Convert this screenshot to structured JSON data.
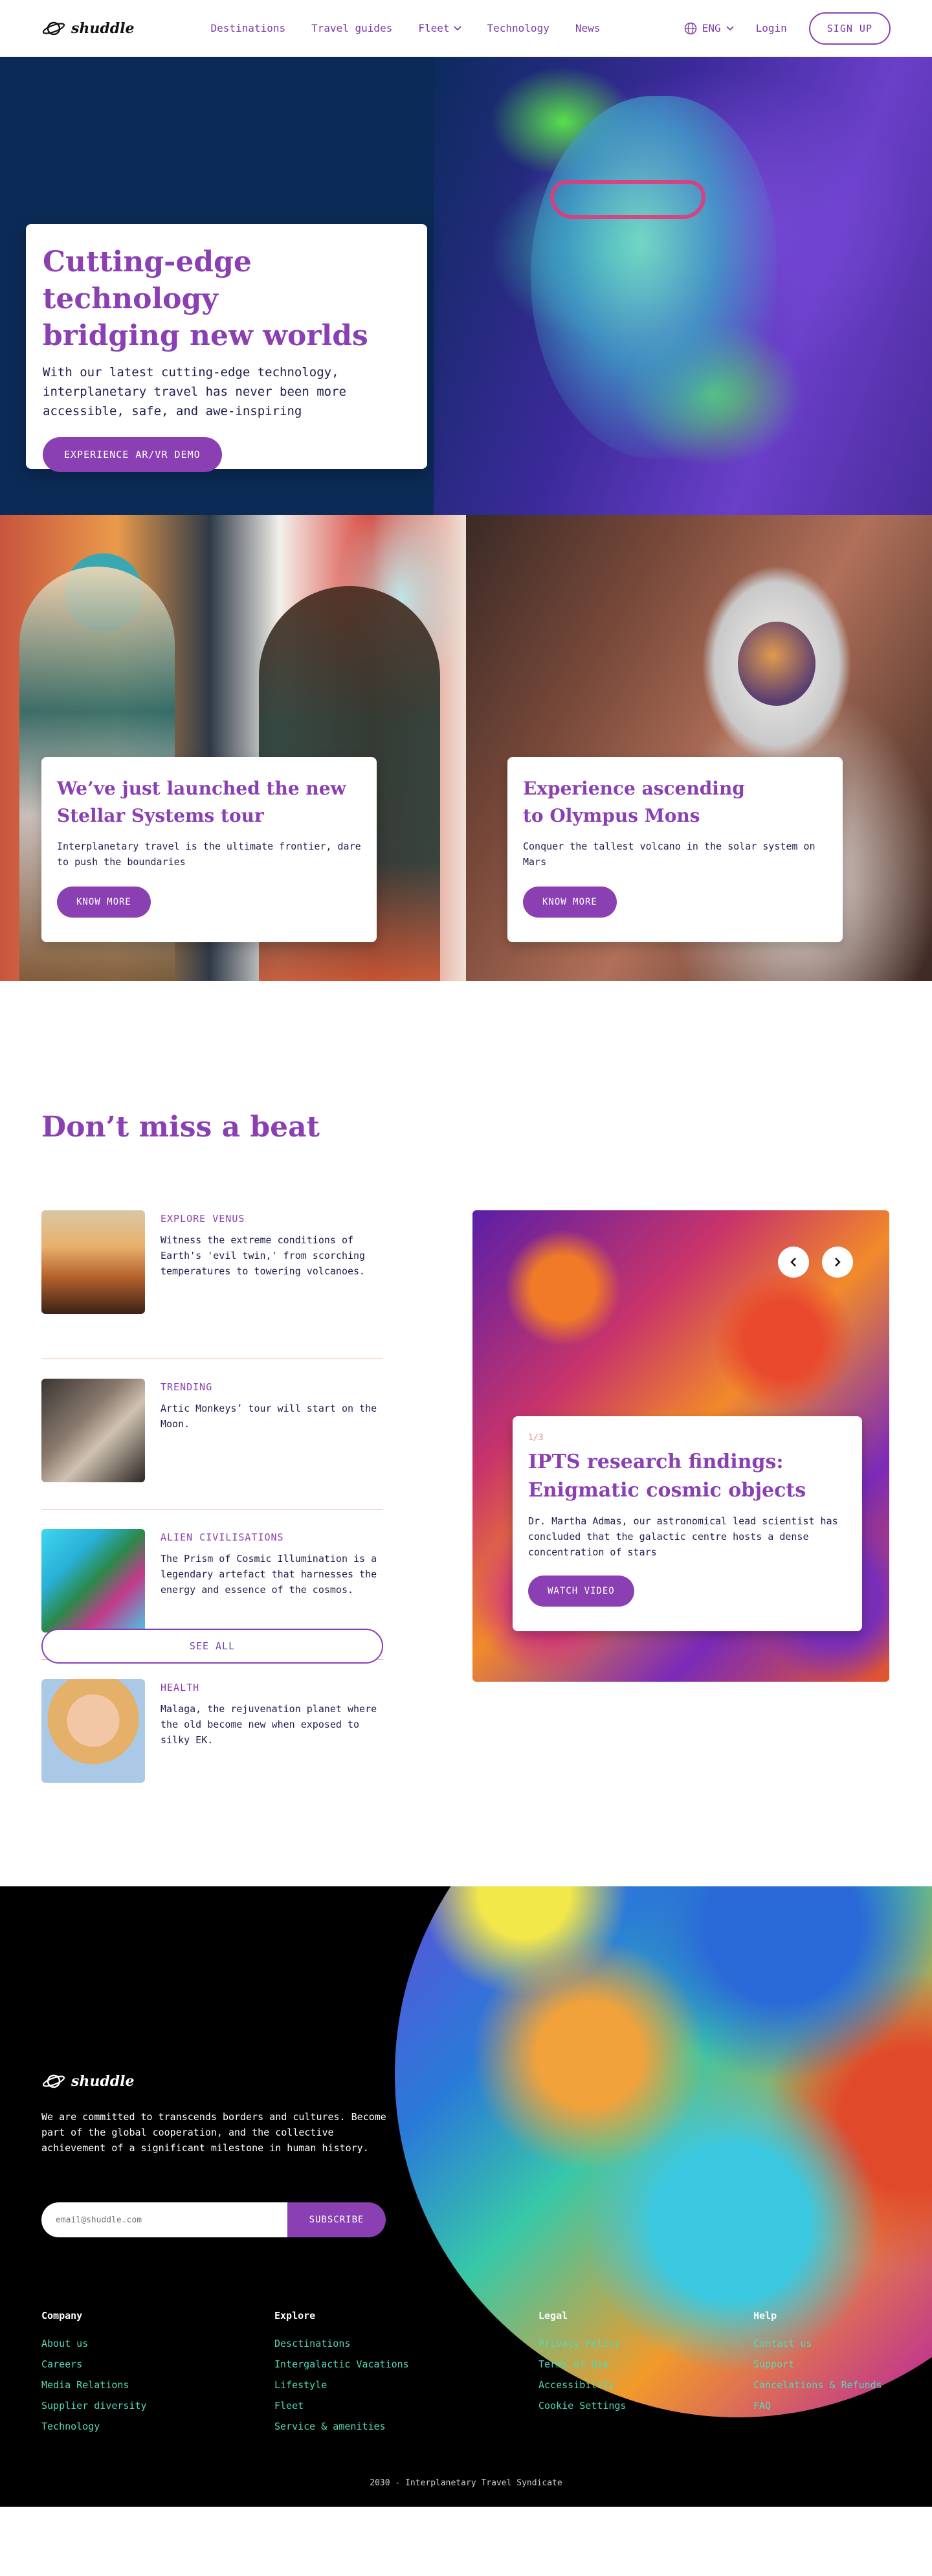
{
  "brand": {
    "name": "shuddle"
  },
  "nav": {
    "links": [
      "Destinations",
      "Travel guides",
      "Fleet",
      "Technology",
      "News"
    ],
    "language": "ENG",
    "login": "Login",
    "signup": "SIGN UP"
  },
  "hero": {
    "title_line1": "Cutting-edge technology",
    "title_line2": "bridging new worlds",
    "body": "With our latest cutting-edge technology, interplanetary travel has never been more accessible, safe, and awe-inspiring",
    "cta": "EXPERIENCE AR/VR DEMO"
  },
  "promos": [
    {
      "title_line1": "We’ve just launched the new",
      "title_line2": "Stellar Systems tour",
      "body": "Interplanetary travel is the ultimate frontier, dare to push the boundaries",
      "cta": "KNOW MORE"
    },
    {
      "title_line1": "Experience ascending",
      "title_line2": "to Olympus Mons",
      "body": "Conquer the tallest volcano in the solar system on Mars",
      "cta": "KNOW MORE"
    }
  ],
  "news": {
    "heading": "Don’t miss a beat",
    "items": [
      {
        "category": "EXPLORE VENUS",
        "text": "Witness the extreme conditions of Earth's 'evil twin,' from scorching temperatures to towering volcanoes."
      },
      {
        "category": "TRENDING",
        "text": "Artic Monkeys’ tour will start on the Moon."
      },
      {
        "category": "ALIEN CIVILISATIONS",
        "text": "The Prism of Cosmic Illumination is a legendary artefact that harnesses the energy and essence of the cosmos."
      },
      {
        "category": "HEALTH",
        "text": "Malaga, the rejuvenation planet where the old become new when exposed to silky EK."
      }
    ],
    "see_all": "SEE ALL",
    "feature": {
      "counter": "1/3",
      "title_line1": "IPTS research findings:",
      "title_line2": "Enigmatic cosmic objects",
      "body": "Dr. Martha Admas, our astronomical lead scientist has concluded that the galactic centre hosts a dense concentration of stars",
      "cta": "WATCH VIDEO"
    }
  },
  "footer": {
    "about": "We are committed to transcends borders and cultures. Become part of the global cooperation, and the collective achievement of a significant milestone in human history.",
    "email_placeholder": "email@shuddle.com",
    "subscribe": "SUBSCRIBE",
    "columns": [
      {
        "title": "Company",
        "links": [
          "About us",
          "Careers",
          "Media Relations",
          "Supplier diversity",
          "Technology"
        ]
      },
      {
        "title": "Explore",
        "links": [
          "Desctinations",
          "Intergalactic Vacations",
          "Lifestyle",
          "Fleet",
          "Service & amenities"
        ]
      },
      {
        "title": "Legal",
        "links": [
          "Privacy Policy",
          "Terms of Use",
          "Accessibility",
          "Cookie Settings"
        ]
      },
      {
        "title": "Help",
        "links": [
          "Contact us",
          "Support",
          "Cancelations & Refunds",
          "FAQ"
        ]
      }
    ],
    "copyright": "2030 - Interplanetary Travel Syndicate"
  },
  "colors": {
    "accent": "#8a3fb3",
    "footer_link": "#55d8b8",
    "divider": "#f2a89e"
  }
}
